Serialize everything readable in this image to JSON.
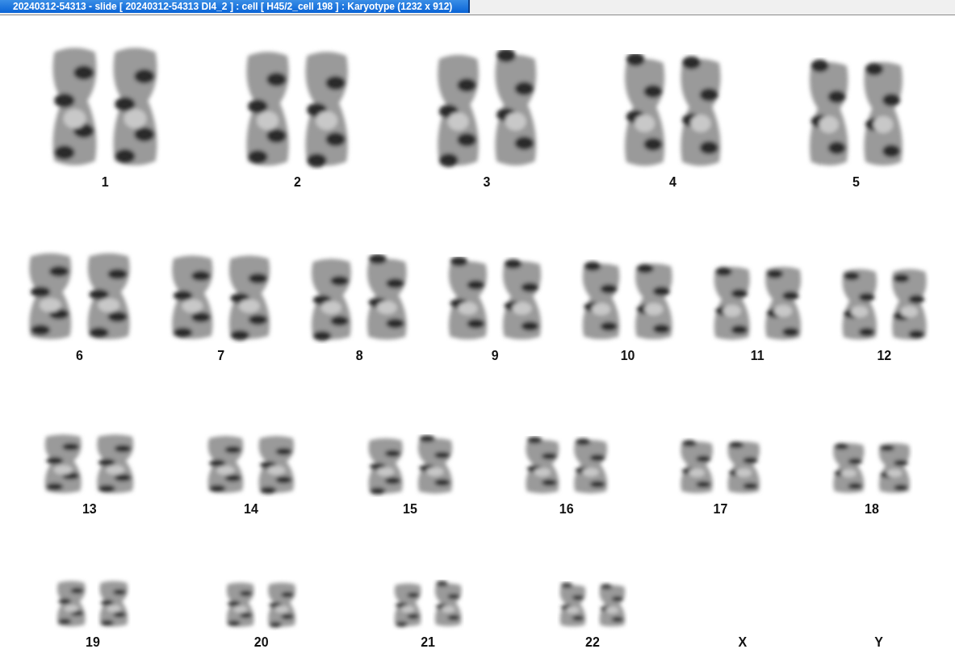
{
  "window": {
    "title": "20240312-54313 - slide [ 20240312-54313 DI4_2 ] : cell [ H45/2_cell 198 ] : Karyotype  (1232 x 912)"
  },
  "karyotype": {
    "rows": [
      [
        {
          "label": "1",
          "kind": "pair"
        },
        {
          "label": "2",
          "kind": "pair"
        },
        {
          "label": "3",
          "kind": "pair"
        },
        {
          "label": "4",
          "kind": "pair"
        },
        {
          "label": "5",
          "kind": "pair"
        }
      ],
      [
        {
          "label": "6",
          "kind": "pair"
        },
        {
          "label": "7",
          "kind": "pair"
        },
        {
          "label": "8",
          "kind": "pair"
        },
        {
          "label": "9",
          "kind": "pair"
        },
        {
          "label": "10",
          "kind": "pair"
        },
        {
          "label": "11",
          "kind": "pair"
        },
        {
          "label": "12",
          "kind": "pair"
        }
      ],
      [
        {
          "label": "13",
          "kind": "pair"
        },
        {
          "label": "14",
          "kind": "pair"
        },
        {
          "label": "15",
          "kind": "pair"
        },
        {
          "label": "16",
          "kind": "pair"
        },
        {
          "label": "17",
          "kind": "pair"
        },
        {
          "label": "18",
          "kind": "pair"
        }
      ],
      [
        {
          "label": "19",
          "kind": "pair"
        },
        {
          "label": "20",
          "kind": "pair"
        },
        {
          "label": "21",
          "kind": "pair"
        },
        {
          "label": "22",
          "kind": "pair"
        },
        {
          "label": "X",
          "kind": "empty"
        },
        {
          "label": "Y",
          "kind": "empty"
        }
      ]
    ]
  }
}
